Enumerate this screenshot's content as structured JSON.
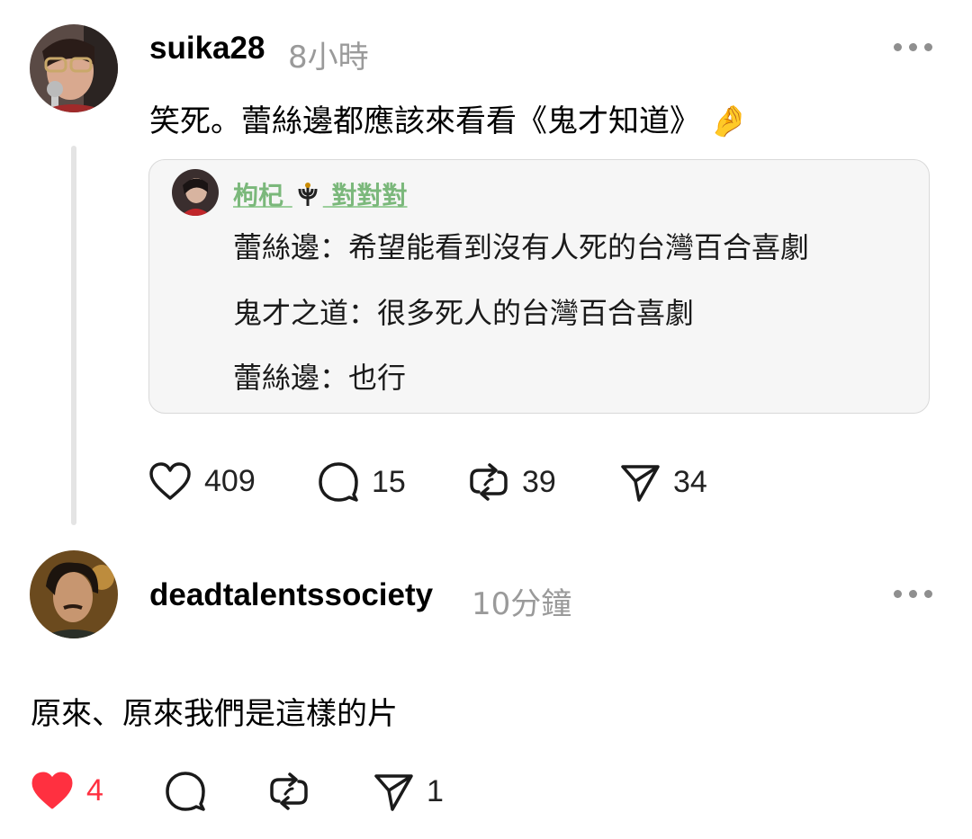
{
  "post1": {
    "username": "suika28",
    "time": "8小時",
    "text": "笑死。蕾絲邊都應該來看看《鬼才知道》",
    "emoji": "🤌",
    "quote": {
      "name": "枸杞",
      "badge": "對對對",
      "lines": [
        "蕾絲邊：希望能看到沒有人死的台灣百合喜劇",
        "鬼才之道：很多死人的台灣百合喜劇",
        "蕾絲邊：也行"
      ]
    },
    "actions": {
      "likes": "409",
      "comments": "15",
      "reposts": "39",
      "shares": "34"
    }
  },
  "post2": {
    "username": "deadtalentssociety",
    "time": "10分鐘",
    "text": "原來、原來我們是這樣的片",
    "actions": {
      "likes": "4",
      "comments": "",
      "reposts": "",
      "shares": "1"
    },
    "liked": true
  },
  "colors": {
    "like_active": "#ff3040",
    "quote_name": "#7bb87b",
    "muted": "#9a9a9a"
  },
  "icons": [
    "heart-icon",
    "comment-icon",
    "repost-icon",
    "share-icon",
    "more-icon",
    "scepter-badge-icon"
  ]
}
